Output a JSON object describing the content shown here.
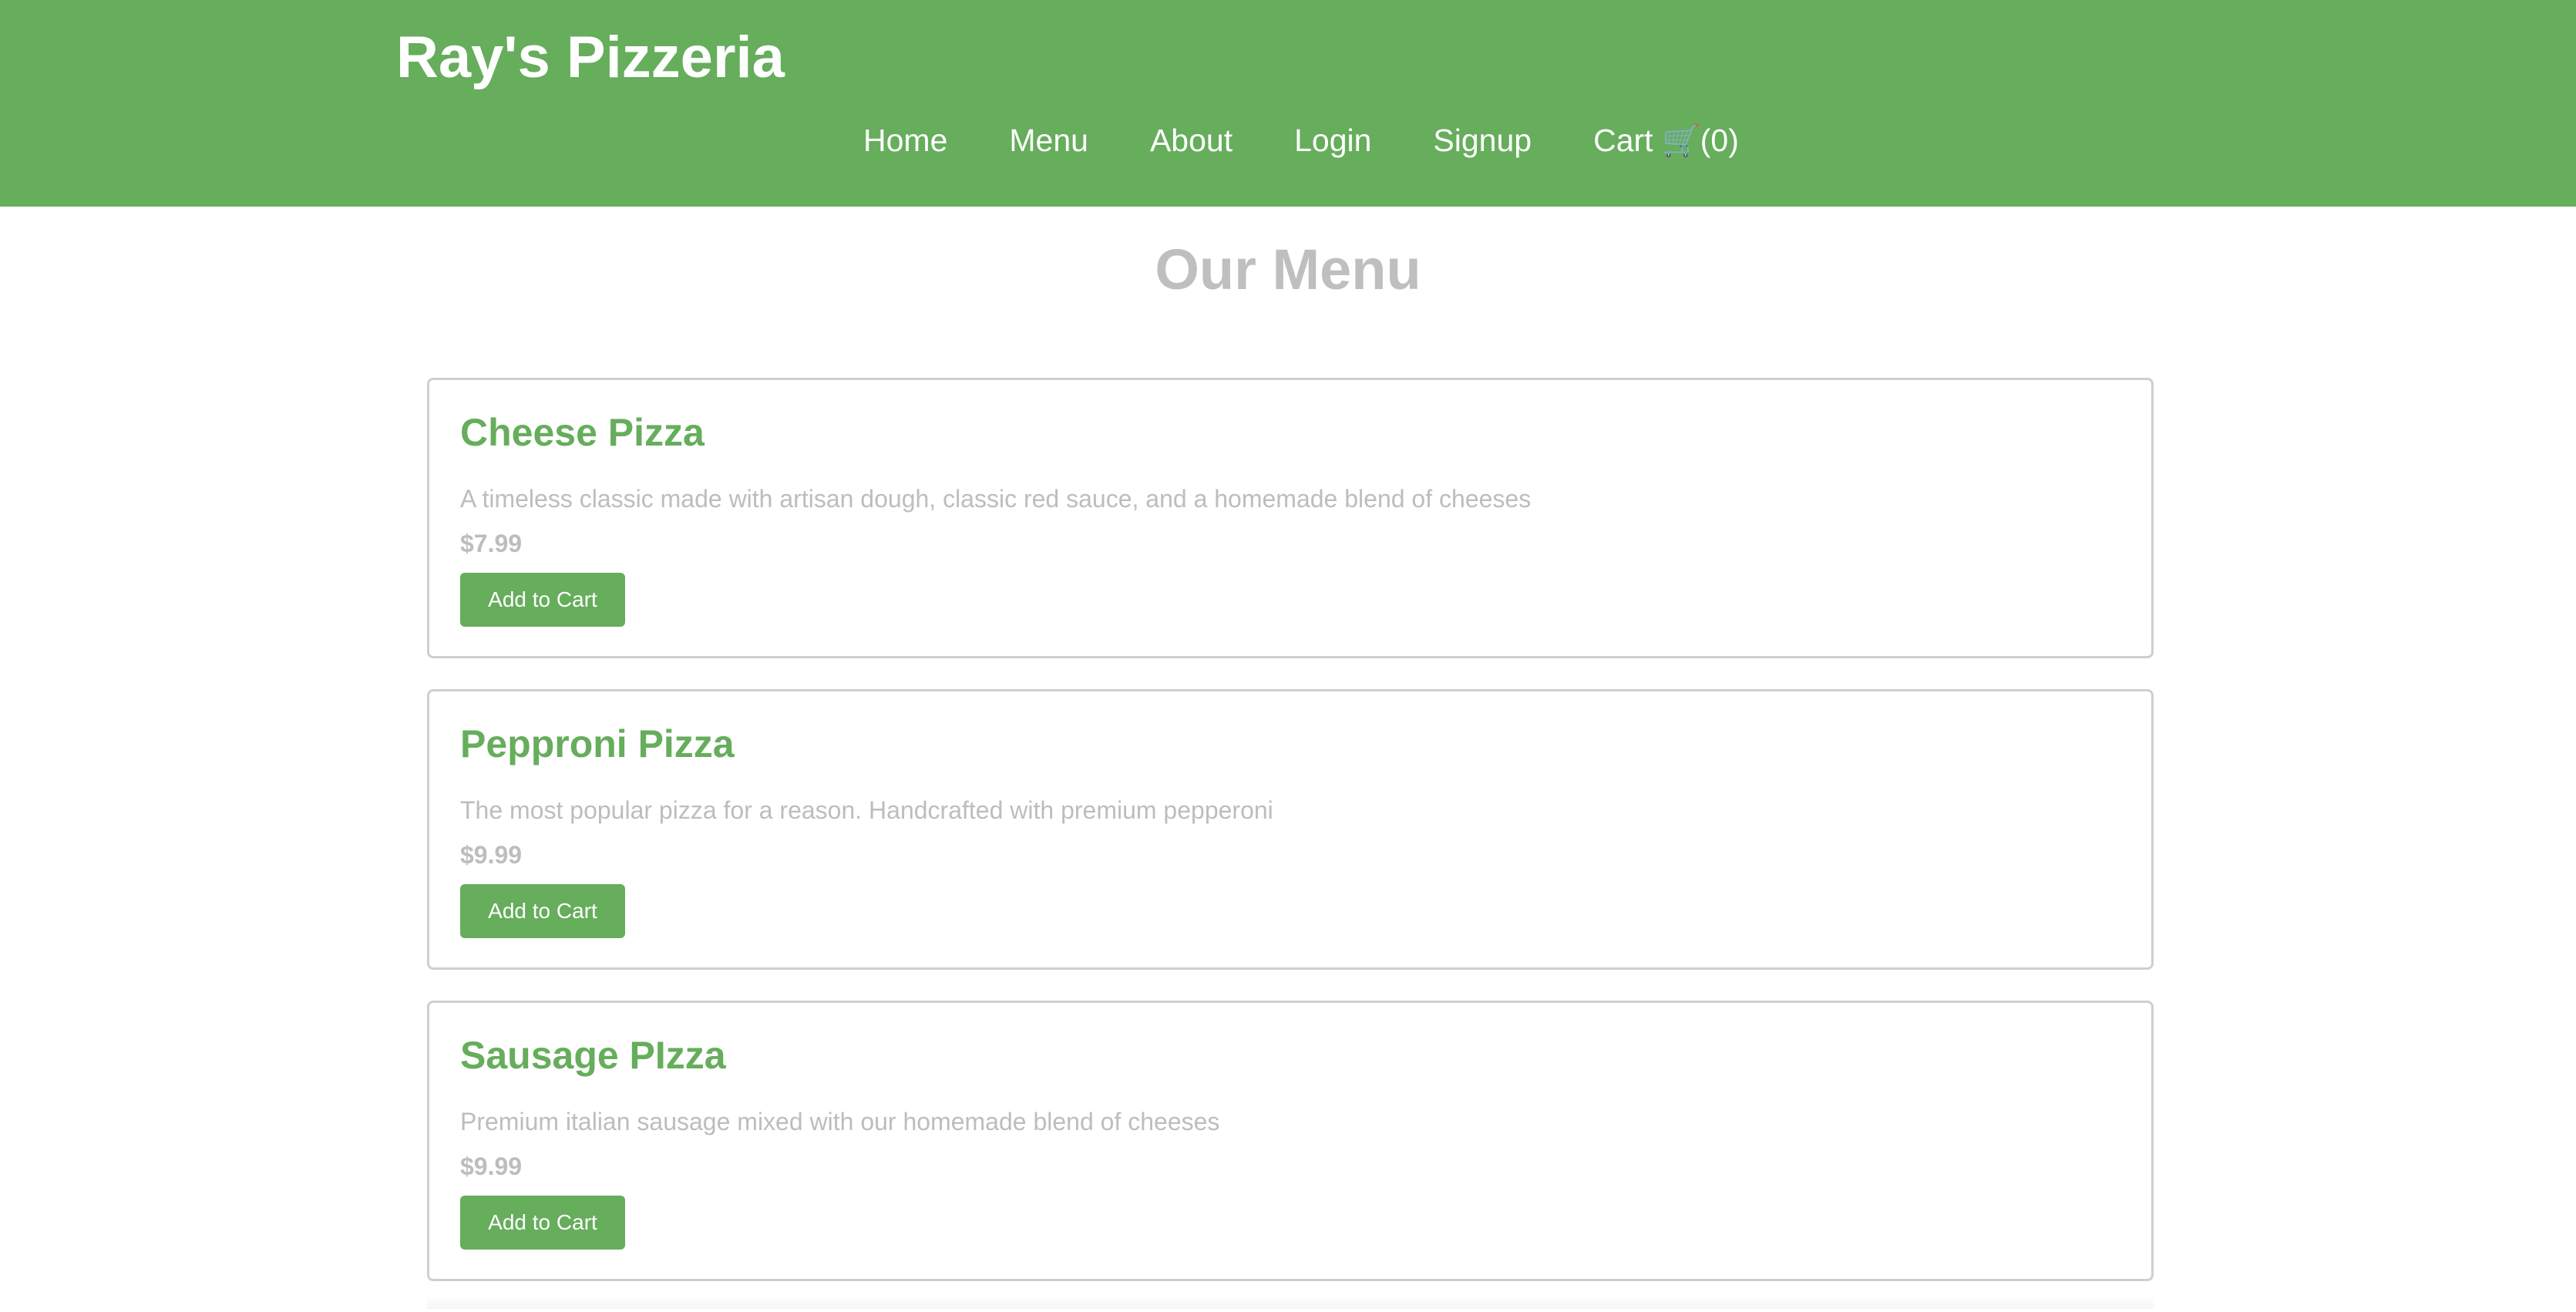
{
  "header": {
    "brand": "Ray's Pizzeria",
    "nav": [
      {
        "label": "Home"
      },
      {
        "label": "Menu"
      },
      {
        "label": "About"
      },
      {
        "label": "Login"
      },
      {
        "label": "Signup"
      }
    ],
    "cart": {
      "label": "Cart ",
      "icon": "🛒",
      "count_text": "(0)"
    }
  },
  "main": {
    "title": "Our Menu",
    "items": [
      {
        "name": "Cheese Pizza",
        "description": "A timeless classic made with artisan dough, classic red sauce, and a homemade blend of cheeses",
        "price": "$7.99",
        "button_label": "Add to Cart"
      },
      {
        "name": "Pepproni Pizza",
        "description": "The most popular pizza for a reason. Handcrafted with premium pepperoni",
        "price": "$9.99",
        "button_label": "Add to Cart"
      },
      {
        "name": "Sausage PIzza",
        "description": "Premium italian sausage mixed with our homemade blend of cheeses",
        "price": "$9.99",
        "button_label": "Add to Cart"
      }
    ]
  },
  "colors": {
    "brand_green": "#66ad5c",
    "muted_text": "#bdbdbd",
    "card_border": "#cfcfcf"
  }
}
